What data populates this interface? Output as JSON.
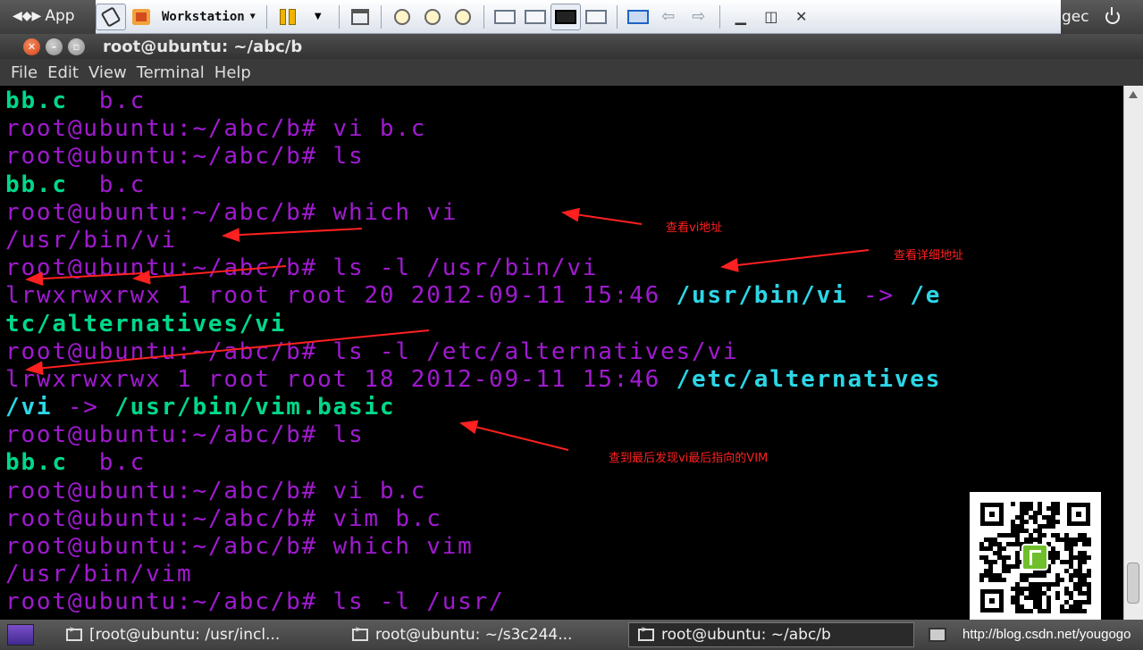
{
  "panel": {
    "apps_label": "App",
    "workstation_label": "Workstation",
    "user_label": "gec"
  },
  "window": {
    "title": "root@ubuntu: ~/abc/b",
    "menu": [
      "File",
      "Edit",
      "View",
      "Terminal",
      "Help"
    ]
  },
  "terminal": {
    "colors": {
      "background": "#000000",
      "prompt": "#a01ad0",
      "file": "#00d98a",
      "symlink": "#2dd6e6"
    },
    "lines": [
      [
        {
          "t": "bb.c",
          "s": "file"
        },
        {
          "t": "  b.c",
          "s": "plain"
        }
      ],
      [
        {
          "t": "root@ubuntu:~/abc/b# vi b.c",
          "s": "prompt"
        }
      ],
      [
        {
          "t": "root@ubuntu:~/abc/b# ls",
          "s": "prompt"
        }
      ],
      [
        {
          "t": "bb.c",
          "s": "file"
        },
        {
          "t": "  b.c",
          "s": "plain"
        }
      ],
      [
        {
          "t": "root@ubuntu:~/abc/b# which vi",
          "s": "prompt"
        }
      ],
      [
        {
          "t": "/usr/bin/vi",
          "s": "out"
        }
      ],
      [
        {
          "t": "root@ubuntu:~/abc/b# ls -l /usr/bin/vi",
          "s": "prompt"
        }
      ],
      [
        {
          "t": "lrwxrwxrwx 1 root root 20 2012-09-11 15:46 ",
          "s": "out"
        },
        {
          "t": "/usr/bin/vi",
          "s": "link"
        },
        {
          "t": " -> ",
          "s": "out"
        },
        {
          "t": "/e",
          "s": "link"
        }
      ],
      [
        {
          "t": "tc/alternatives/vi",
          "s": "exec"
        }
      ],
      [
        {
          "t": "root@ubuntu:~/abc/b# ls -l /etc/alternatives/vi",
          "s": "prompt"
        }
      ],
      [
        {
          "t": "lrwxrwxrwx 1 root root 18 2012-09-11 15:46 ",
          "s": "out"
        },
        {
          "t": "/etc/alternatives",
          "s": "link"
        }
      ],
      [
        {
          "t": "/vi",
          "s": "link"
        },
        {
          "t": " -> ",
          "s": "out"
        },
        {
          "t": "/usr/bin/vim.basic",
          "s": "exec"
        }
      ],
      [
        {
          "t": "root@ubuntu:~/abc/b# ls",
          "s": "prompt"
        }
      ],
      [
        {
          "t": "bb.c",
          "s": "file"
        },
        {
          "t": "  b.c",
          "s": "plain"
        }
      ],
      [
        {
          "t": "root@ubuntu:~/abc/b# vi b.c",
          "s": "prompt"
        }
      ],
      [
        {
          "t": "root@ubuntu:~/abc/b# vim b.c",
          "s": "prompt"
        }
      ],
      [
        {
          "t": "root@ubuntu:~/abc/b# which vim",
          "s": "prompt"
        }
      ],
      [
        {
          "t": "/usr/bin/vim",
          "s": "out"
        }
      ],
      [
        {
          "t": "root@ubuntu:~/abc/b# ls -l /usr/",
          "s": "prompt"
        }
      ]
    ]
  },
  "annotations": {
    "color": "#ff2020",
    "notes": [
      "查看vi地址",
      "查看详细地址",
      "查到最后发现vi最后指向的VIM"
    ]
  },
  "taskbar": {
    "tasks": [
      "[root@ubuntu: /usr/incl...",
      "root@ubuntu: ~/s3c244...",
      "root@ubuntu: ~/abc/b"
    ],
    "watermark": "http://blog.csdn.net/yougogo"
  }
}
